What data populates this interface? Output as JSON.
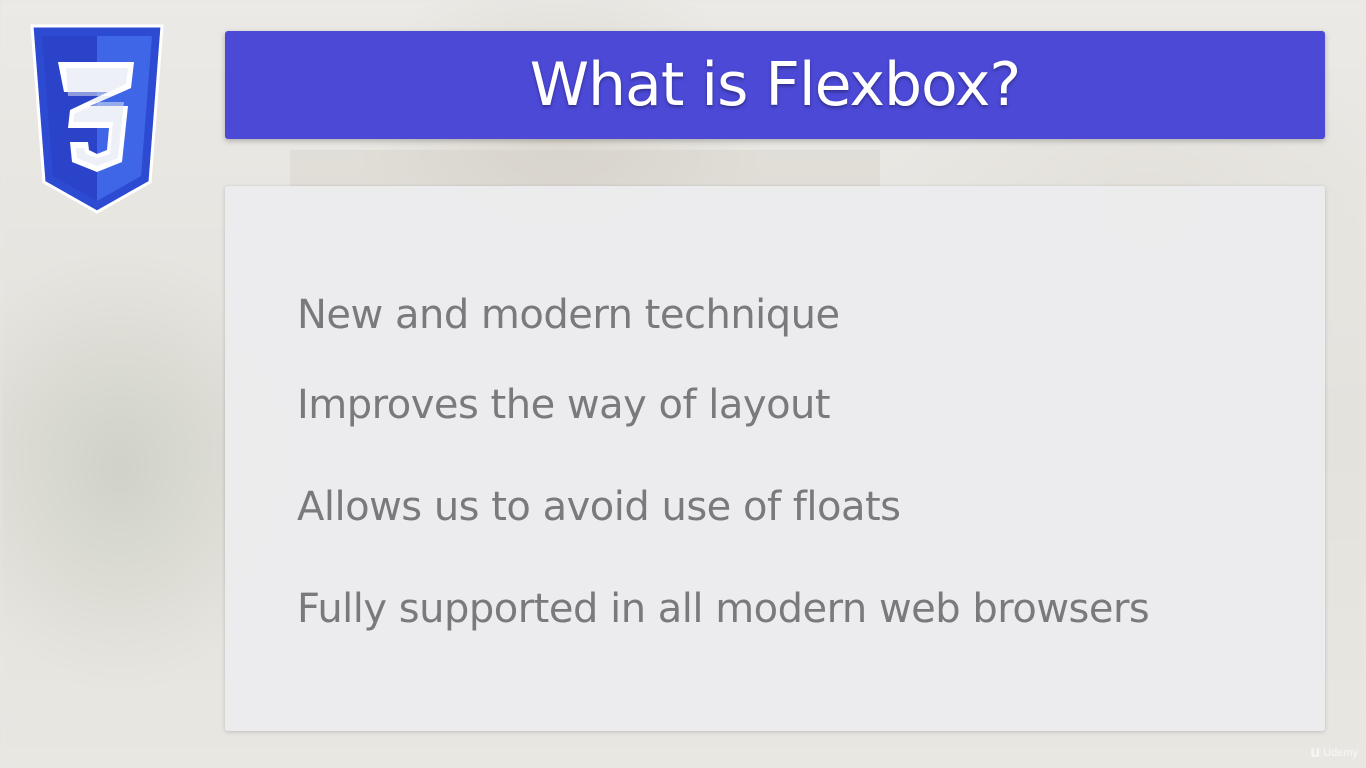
{
  "slide": {
    "title": "What is Flexbox?",
    "bullets": [
      "New and modern technique",
      "Improves the way of layout",
      "Allows us to avoid use of floats",
      "Fully supported in all modern web browsers"
    ]
  },
  "logo": {
    "icon": "css3-shield-icon",
    "label": "3"
  },
  "watermark": {
    "mark": "u",
    "text": "Udemy"
  },
  "colors": {
    "banner": "#4b49d6",
    "logo_blue": "#2f4bd6",
    "bullet_text": "#7a7a7c"
  }
}
